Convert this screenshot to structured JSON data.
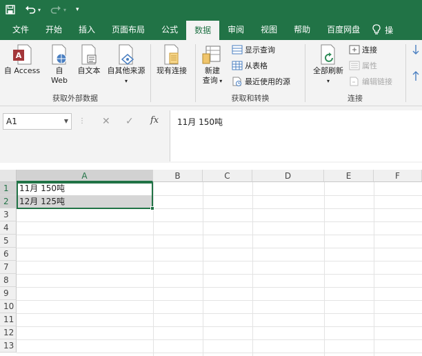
{
  "tabs": [
    "文件",
    "开始",
    "插入",
    "页面布局",
    "公式",
    "数据",
    "审阅",
    "视图",
    "帮助",
    "百度网盘"
  ],
  "tell_me": "操",
  "ribbon": {
    "get_external": {
      "label": "获取外部数据",
      "access": "自 Access",
      "web_line1": "自",
      "web_line2": "Web",
      "text": "自文本",
      "other": "自其他来源"
    },
    "existing": "现有连接",
    "transform": {
      "label": "获取和转换",
      "new_query_line1": "新建",
      "new_query_line2": "查询",
      "show_query": "显示查询",
      "from_table": "从表格",
      "recent_sources": "最近使用的源"
    },
    "connections": {
      "label": "连接",
      "refresh_all": "全部刷新",
      "connections": "连接",
      "properties": "属性",
      "edit_links": "编辑链接"
    }
  },
  "formula_bar": {
    "name_box": "A1",
    "value": "11月 150吨"
  },
  "columns": [
    "A",
    "B",
    "C",
    "D",
    "E",
    "F"
  ],
  "rows": [
    "1",
    "2",
    "3",
    "4",
    "5",
    "6",
    "7",
    "8",
    "9",
    "10",
    "11",
    "12",
    "13"
  ],
  "cells": {
    "a1": "11月 150吨",
    "a2": "12月 125吨"
  },
  "colors": {
    "accent": "#217346",
    "ribbon_bg": "#f3f3f3"
  }
}
